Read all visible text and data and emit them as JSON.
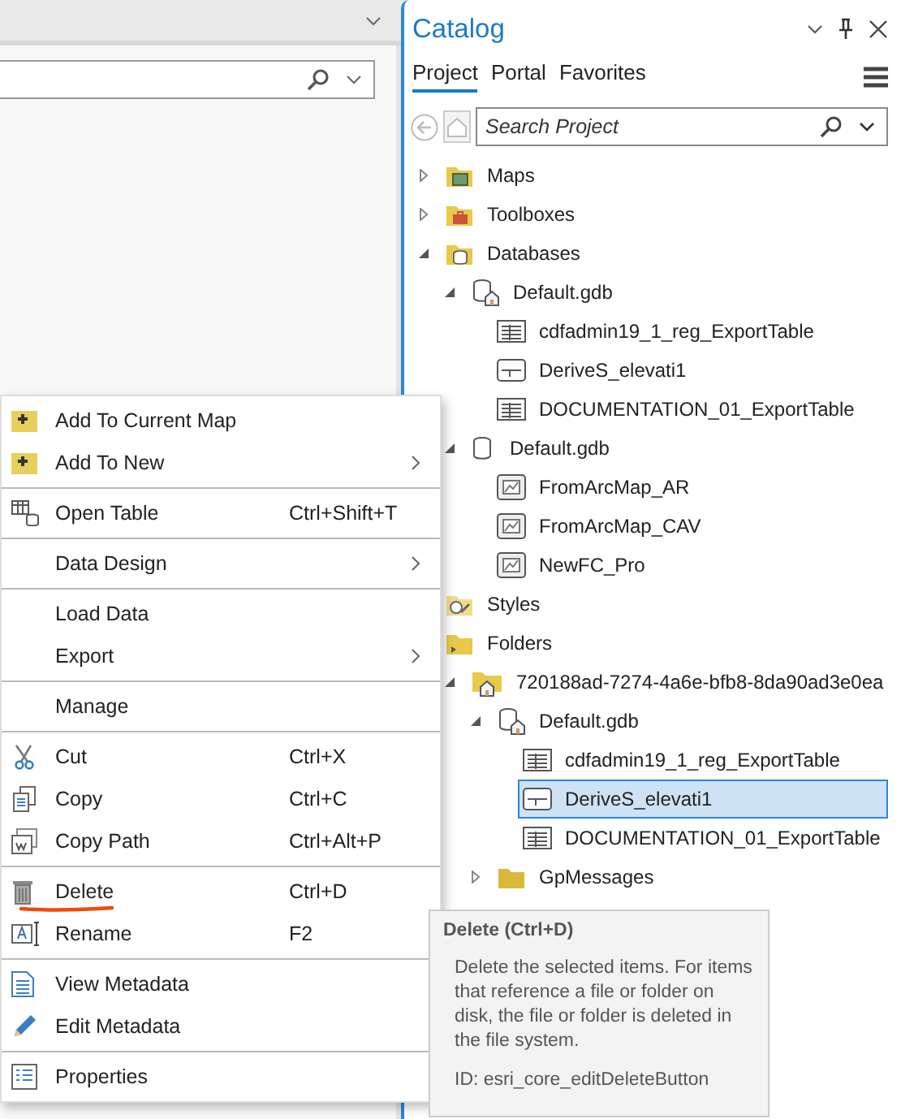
{
  "catalog": {
    "title": "Catalog",
    "tabs": [
      {
        "label": "Project",
        "selected": true
      },
      {
        "label": "Portal",
        "selected": false
      },
      {
        "label": "Favorites",
        "selected": false
      }
    ],
    "search": {
      "placeholder": "Search Project"
    },
    "tree": [
      {
        "label": "Maps",
        "kind": "maps-folder",
        "expanded": false,
        "selected": false
      },
      {
        "label": "Toolboxes",
        "kind": "toolbox-folder",
        "expanded": false,
        "selected": false
      },
      {
        "label": "Databases",
        "kind": "database-folder",
        "expanded": true,
        "selected": false,
        "children": [
          {
            "label": "Default.gdb",
            "kind": "home-database",
            "expanded": true,
            "selected": false,
            "children": [
              {
                "label": "cdfadmin19_1_reg_ExportTable",
                "kind": "table",
                "selected": false
              },
              {
                "label": "DeriveS_elevati1",
                "kind": "raster",
                "selected": false
              },
              {
                "label": "DOCUMENTATION_01_ExportTable",
                "kind": "table",
                "selected": false
              }
            ]
          },
          {
            "label": "Default.gdb",
            "kind": "database",
            "expanded": true,
            "selected": false,
            "children": [
              {
                "label": "FromArcMap_AR",
                "kind": "feature-class",
                "selected": false
              },
              {
                "label": "FromArcMap_CAV",
                "kind": "feature-class",
                "selected": false
              },
              {
                "label": "NewFC_Pro",
                "kind": "feature-class",
                "selected": false
              }
            ]
          }
        ]
      },
      {
        "label": "Styles",
        "kind": "styles-folder",
        "selected": false
      },
      {
        "label": "Folders",
        "kind": "folders",
        "selected": false,
        "children": [
          {
            "label": "720188ad-7274-4a6e-bfb8-8da90ad3e0ea",
            "kind": "home-folder",
            "expanded": true,
            "selected": false,
            "children": [
              {
                "label": "Default.gdb",
                "kind": "home-database",
                "expanded": true,
                "selected": false,
                "children": [
                  {
                    "label": "cdfadmin19_1_reg_ExportTable",
                    "kind": "table",
                    "selected": false
                  },
                  {
                    "label": "DeriveS_elevati1",
                    "kind": "raster",
                    "selected": true
                  },
                  {
                    "label": "DOCUMENTATION_01_ExportTable",
                    "kind": "table",
                    "selected": false
                  }
                ]
              },
              {
                "label": "GpMessages",
                "kind": "folder",
                "expanded": false,
                "selected": false
              }
            ]
          }
        ]
      }
    ]
  },
  "context_menu": {
    "groups": [
      {
        "items": [
          {
            "label": "Add To Current Map",
            "kind": "add-layer"
          },
          {
            "label": "Add To New",
            "kind": "add-layer",
            "submenu": true
          }
        ]
      },
      {
        "items": [
          {
            "label": "Open Table",
            "kind": "open-table",
            "shortcut": "Ctrl+Shift+T"
          }
        ]
      },
      {
        "items": [
          {
            "label": "Data Design",
            "submenu": true
          }
        ]
      },
      {
        "items": [
          {
            "label": "Load Data"
          },
          {
            "label": "Export",
            "submenu": true
          }
        ]
      },
      {
        "items": [
          {
            "label": "Manage"
          }
        ]
      },
      {
        "items": [
          {
            "label": "Cut",
            "kind": "cut",
            "shortcut": "Ctrl+X"
          },
          {
            "label": "Copy",
            "kind": "copy",
            "shortcut": "Ctrl+C"
          },
          {
            "label": "Copy Path",
            "kind": "copy-path",
            "shortcut": "Ctrl+Alt+P"
          }
        ]
      },
      {
        "items": [
          {
            "label": "Delete",
            "kind": "delete",
            "shortcut": "Ctrl+D",
            "marked": true
          },
          {
            "label": "Rename",
            "kind": "rename",
            "shortcut": "F2"
          }
        ]
      },
      {
        "items": [
          {
            "label": "View Metadata",
            "kind": "view-metadata"
          },
          {
            "label": "Edit Metadata",
            "kind": "edit-metadata"
          }
        ]
      },
      {
        "items": [
          {
            "label": "Properties",
            "kind": "properties"
          }
        ]
      }
    ]
  },
  "tooltip": {
    "title": "Delete (Ctrl+D)",
    "body": "Delete the selected items. For items that reference a file or folder on disk, the file or folder is deleted in the file system.",
    "id": "ID: esri_core_editDeleteButton"
  }
}
